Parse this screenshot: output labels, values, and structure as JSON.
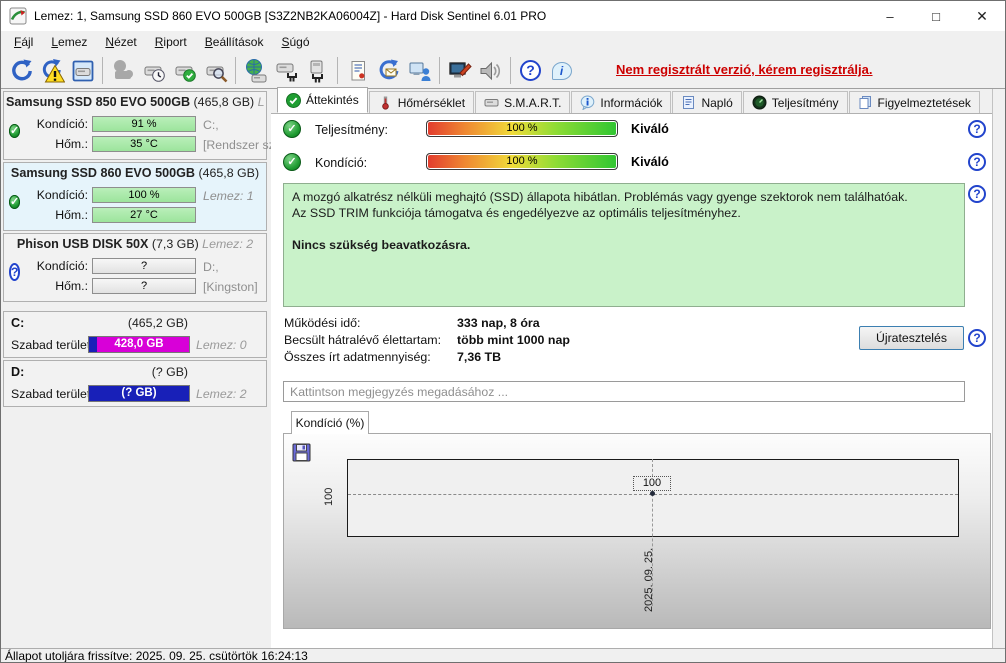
{
  "window": {
    "title": "Lemez: 1, Samsung SSD 860 EVO 500GB [S3Z2NB2KA06004Z]  -  Hard Disk Sentinel 6.01 PRO"
  },
  "glyphs": {
    "check": "✓",
    "question": "?",
    "info": "i",
    "minimize": "–",
    "maximize": "□",
    "close": "✕"
  },
  "menu": {
    "items": [
      "Fájl",
      "Lemez",
      "Nézet",
      "Riport",
      "Beállítások",
      "Súgó"
    ]
  },
  "toolbar": {
    "registration": "Nem regisztrált verzió, kérem regisztrálja."
  },
  "sidebar": {
    "disks": [
      {
        "model": "Samsung SSD 850 EVO 500GB",
        "size": "(465,8 GB)",
        "note": "Le",
        "condition_label": "Kondíció:",
        "condition_value": "91 %",
        "drive": "C:,",
        "temp_label": "Hőm.:",
        "temp_value": "35 °C",
        "extra": "[Rendszer szá"
      },
      {
        "model": "Samsung SSD 860 EVO 500GB",
        "size": "(465,8 GB)",
        "note": "",
        "condition_label": "Kondíció:",
        "condition_value": "100 %",
        "drive": "Lemez: 1",
        "temp_label": "Hőm.:",
        "temp_value": "27 °C",
        "extra": ""
      },
      {
        "model": "Phison  USB DISK 50X",
        "size": "(7,3 GB)",
        "note": "Lemez: 2",
        "condition_label": "Kondíció:",
        "condition_value": "?",
        "drive": "D:,",
        "temp_label": "Hőm.:",
        "temp_value": "?",
        "extra": "[Kingston]"
      }
    ],
    "partitions": [
      {
        "letter": "C:",
        "size": "(465,2 GB)",
        "free_label": "Szabad terület",
        "free_value": "428,0 GB",
        "note": "Lemez: 0"
      },
      {
        "letter": "D:",
        "size": "(? GB)",
        "free_label": "Szabad terület",
        "free_value": "(? GB)",
        "note": "Lemez: 2"
      }
    ]
  },
  "tabs": {
    "items": [
      {
        "label": "Áttekintés",
        "icon": "check-circle-icon"
      },
      {
        "label": "Hőmérséklet",
        "icon": "thermometer-icon"
      },
      {
        "label": "S.M.A.R.T.",
        "icon": "disk-icon"
      },
      {
        "label": "Információk",
        "icon": "info-icon"
      },
      {
        "label": "Napló",
        "icon": "document-icon"
      },
      {
        "label": "Teljesítmény",
        "icon": "gauge-icon"
      },
      {
        "label": "Figyelmeztetések",
        "icon": "pages-icon"
      }
    ]
  },
  "overview": {
    "performance": {
      "label": "Teljesítmény:",
      "value": "100 %",
      "rating": "Kiváló"
    },
    "condition": {
      "label": "Kondíció:",
      "value": "100 %",
      "rating": "Kiváló"
    },
    "status_lines": [
      "A mozgó alkatrész nélküli meghajtó (SSD) állapota hibátlan. Problémás vagy gyenge szektorok nem találhatóak.",
      "Az SSD TRIM funkciója támogatva és engedélyezve az optimális teljesítményhez."
    ],
    "status_bold": "Nincs szükség beavatkozásra.",
    "stats": [
      {
        "label": "Működési idő:",
        "value": "333 nap, 8 óra"
      },
      {
        "label": "Becsült hátralévő élettartam:",
        "value": "több mint 1000 nap"
      },
      {
        "label": "Összes írt adatmennyiség:",
        "value": "7,36 TB"
      }
    ],
    "retest_button": "Újratesztelés",
    "comment_placeholder": "Kattintson megjegyzés megadásához ..."
  },
  "chart": {
    "tab_label": "Kondíció  (%)",
    "y_tick": "100",
    "point_label": "100",
    "x_tick": "2025. 09. 25."
  },
  "chart_data": {
    "type": "line",
    "title": "Kondíció (%)",
    "x": [
      "2025. 09. 25."
    ],
    "values": [
      100
    ],
    "ylim": [
      0,
      100
    ],
    "grid": "dashed-crosshair",
    "legend_position": "none"
  },
  "status_bar": {
    "text": "Állapot utoljára frissítve: 2025. 09. 25. csütörtök 16:24:13"
  },
  "colors": {
    "registration_red": "#cc0000",
    "status_box_green": "#c9f2c9",
    "condition_bar_green": "#a9e8a9",
    "free_space_magenta": "#d800d8",
    "free_space_blue": "#1820b8",
    "gauge_gradient": [
      "#e23b2e",
      "#f0dc3a",
      "#2fc532"
    ]
  }
}
